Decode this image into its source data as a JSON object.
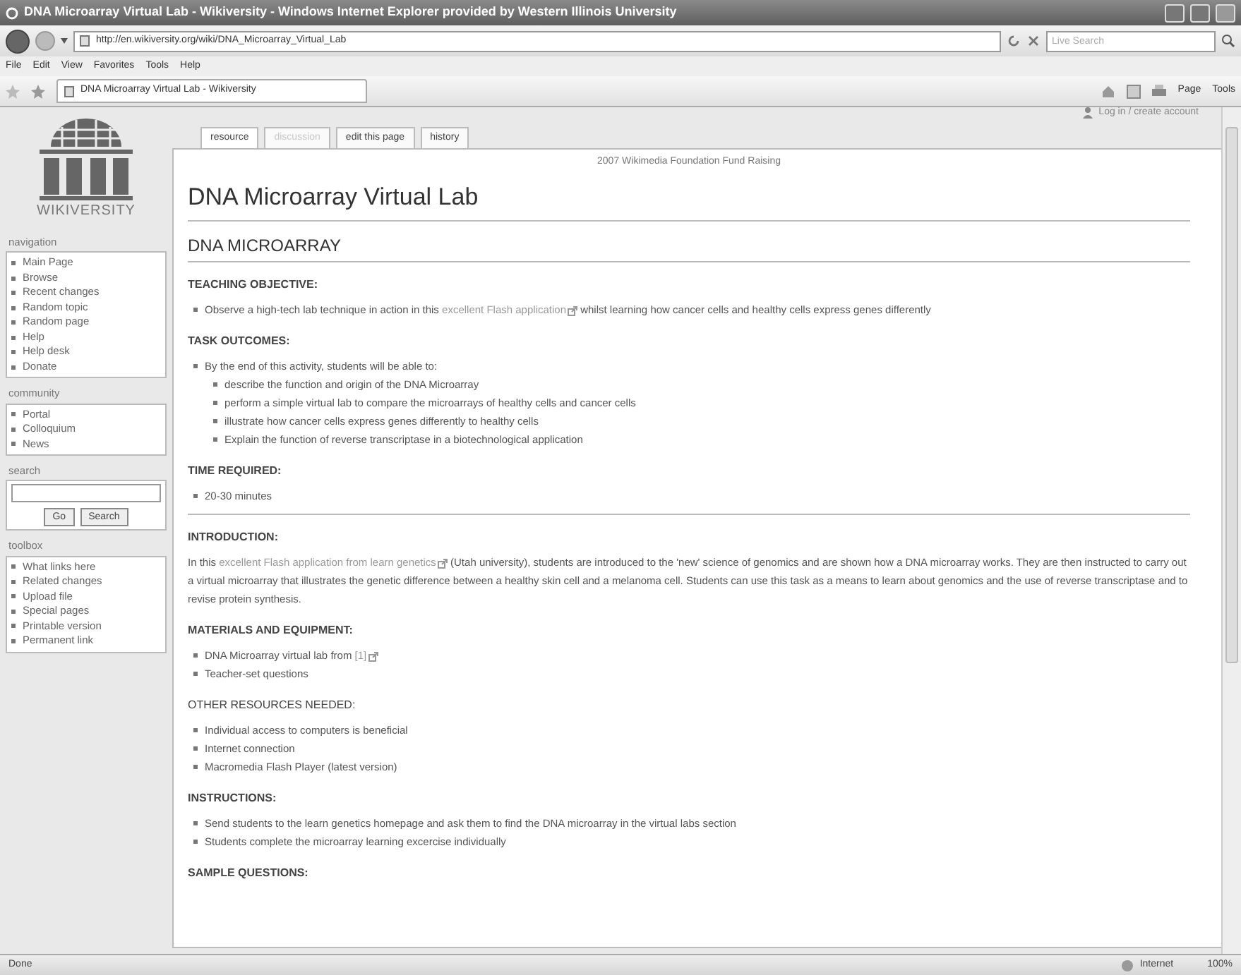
{
  "window": {
    "title": "DNA Microarray Virtual Lab - Wikiversity - Windows Internet Explorer provided by Western Illinois University"
  },
  "browser": {
    "url": "http://en.wikiversity.org/wiki/DNA_Microarray_Virtual_Lab",
    "search": {
      "placeholder": "Live Search"
    },
    "menu": [
      "File",
      "Edit",
      "View",
      "Favorites",
      "Tools",
      "Help"
    ],
    "tab": {
      "title": "DNA Microarray Virtual Lab - Wikiversity"
    },
    "commands": [
      {
        "label": "Page"
      },
      {
        "label": "Tools"
      }
    ]
  },
  "sidebar": {
    "logo_text": "WIKIVERSITY",
    "portlets": [
      {
        "title": "navigation",
        "kind": "links",
        "items": [
          "Main Page",
          "Browse",
          "Recent changes",
          "Random topic",
          "Random page",
          "Help",
          "Help desk",
          "Donate"
        ]
      },
      {
        "title": "community",
        "kind": "links",
        "items": [
          "Portal",
          "Colloquium",
          "News"
        ]
      },
      {
        "title": "search",
        "kind": "search",
        "buttons": [
          "Go",
          "Search"
        ]
      },
      {
        "title": "toolbox",
        "kind": "links",
        "items": [
          "What links here",
          "Related changes",
          "Upload file",
          "Special pages",
          "Printable version",
          "Permanent link"
        ]
      }
    ]
  },
  "page": {
    "user_link": "Log in / create account",
    "tabs": [
      {
        "label": "resource",
        "selected": true,
        "kind": "normal"
      },
      {
        "label": "discussion",
        "selected": false,
        "kind": "missing"
      },
      {
        "label": "edit this page",
        "selected": false,
        "kind": "normal"
      },
      {
        "label": "history",
        "selected": false,
        "kind": "normal"
      }
    ],
    "sitenotice": "2007 Wikimedia Foundation Fund Raising",
    "title": "DNA Microarray Virtual Lab",
    "heading": "DNA MICROARRAY",
    "sections": [
      {
        "heading": "TEACHING OBJECTIVE:",
        "bold": true,
        "rule_after": false,
        "items": [
          {
            "kind": "bullet",
            "segments": [
              {
                "kind": "text",
                "text": "Observe a high-tech lab technique in action in this "
              },
              {
                "kind": "extlink",
                "text": "excellent Flash application"
              },
              {
                "kind": "text",
                "text": " whilst learning how cancer cells and healthy cells express genes differently"
              }
            ]
          }
        ]
      },
      {
        "heading": "TASK OUTCOMES:",
        "bold": true,
        "rule_after": false,
        "items": [
          {
            "kind": "bullet",
            "segments": [
              {
                "kind": "text",
                "text": "By the end of this activity, students will be able to:"
              }
            ],
            "children": [
              {
                "kind": "bullet",
                "segments": [
                  {
                    "kind": "text",
                    "text": "describe the function and origin of the DNA Microarray"
                  }
                ]
              },
              {
                "kind": "bullet",
                "segments": [
                  {
                    "kind": "text",
                    "text": "perform a simple virtual lab to compare the microarrays of healthy cells and cancer cells"
                  }
                ]
              },
              {
                "kind": "bullet",
                "segments": [
                  {
                    "kind": "text",
                    "text": "illustrate how cancer cells express genes differently to healthy cells"
                  }
                ]
              },
              {
                "kind": "bullet",
                "segments": [
                  {
                    "kind": "text",
                    "text": "Explain the function of reverse transcriptase in a biotechnological application"
                  }
                ]
              }
            ]
          }
        ]
      },
      {
        "heading": "TIME REQUIRED:",
        "bold": true,
        "rule_after": true,
        "items": [
          {
            "kind": "bullet",
            "segments": [
              {
                "kind": "text",
                "text": "20-30 minutes"
              }
            ]
          }
        ]
      },
      {
        "heading": "INTRODUCTION:",
        "bold": true,
        "rule_after": false,
        "items": [
          {
            "kind": "paragraph",
            "segments": [
              {
                "kind": "text",
                "text": "In this "
              },
              {
                "kind": "extlink",
                "text": "excellent Flash application from learn genetics"
              },
              {
                "kind": "text",
                "text": " (Utah university), students are introduced to the 'new' science of genomics and are shown how a DNA microarray works. They are then instructed to carry out a virtual microarray that illustrates the genetic difference between a healthy skin cell and a melanoma cell. Students can use this task as a means to learn about genomics and the use of reverse transcriptase and to revise protein synthesis."
              }
            ]
          }
        ]
      },
      {
        "heading": "MATERIALS AND EQUIPMENT:",
        "bold": true,
        "rule_after": false,
        "items": [
          {
            "kind": "bullet",
            "segments": [
              {
                "kind": "text",
                "text": "DNA Microarray virtual lab from "
              },
              {
                "kind": "extlink",
                "text": "[1]"
              }
            ]
          },
          {
            "kind": "bullet",
            "segments": [
              {
                "kind": "text",
                "text": "Teacher-set questions"
              }
            ]
          }
        ]
      },
      {
        "heading": "OTHER RESOURCES NEEDED:",
        "bold": false,
        "rule_after": false,
        "items": [
          {
            "kind": "bullet",
            "segments": [
              {
                "kind": "text",
                "text": "Individual access to computers is beneficial"
              }
            ]
          },
          {
            "kind": "bullet",
            "segments": [
              {
                "kind": "text",
                "text": "Internet connection"
              }
            ]
          },
          {
            "kind": "bullet",
            "segments": [
              {
                "kind": "text",
                "text": "Macromedia Flash Player (latest version)"
              }
            ]
          }
        ]
      },
      {
        "heading": "INSTRUCTIONS:",
        "bold": true,
        "rule_after": false,
        "items": [
          {
            "kind": "bullet",
            "segments": [
              {
                "kind": "text",
                "text": "Send students to the learn genetics homepage and ask them to find the DNA microarray in the virtual labs section"
              }
            ]
          },
          {
            "kind": "bullet",
            "segments": [
              {
                "kind": "text",
                "text": "Students complete the microarray learning excercise individually"
              }
            ]
          }
        ]
      },
      {
        "heading": "SAMPLE QUESTIONS:",
        "bold": true,
        "rule_after": false
      }
    ]
  },
  "status_bar": {
    "text": "Done",
    "zone": "Internet",
    "zoom": "100%"
  }
}
